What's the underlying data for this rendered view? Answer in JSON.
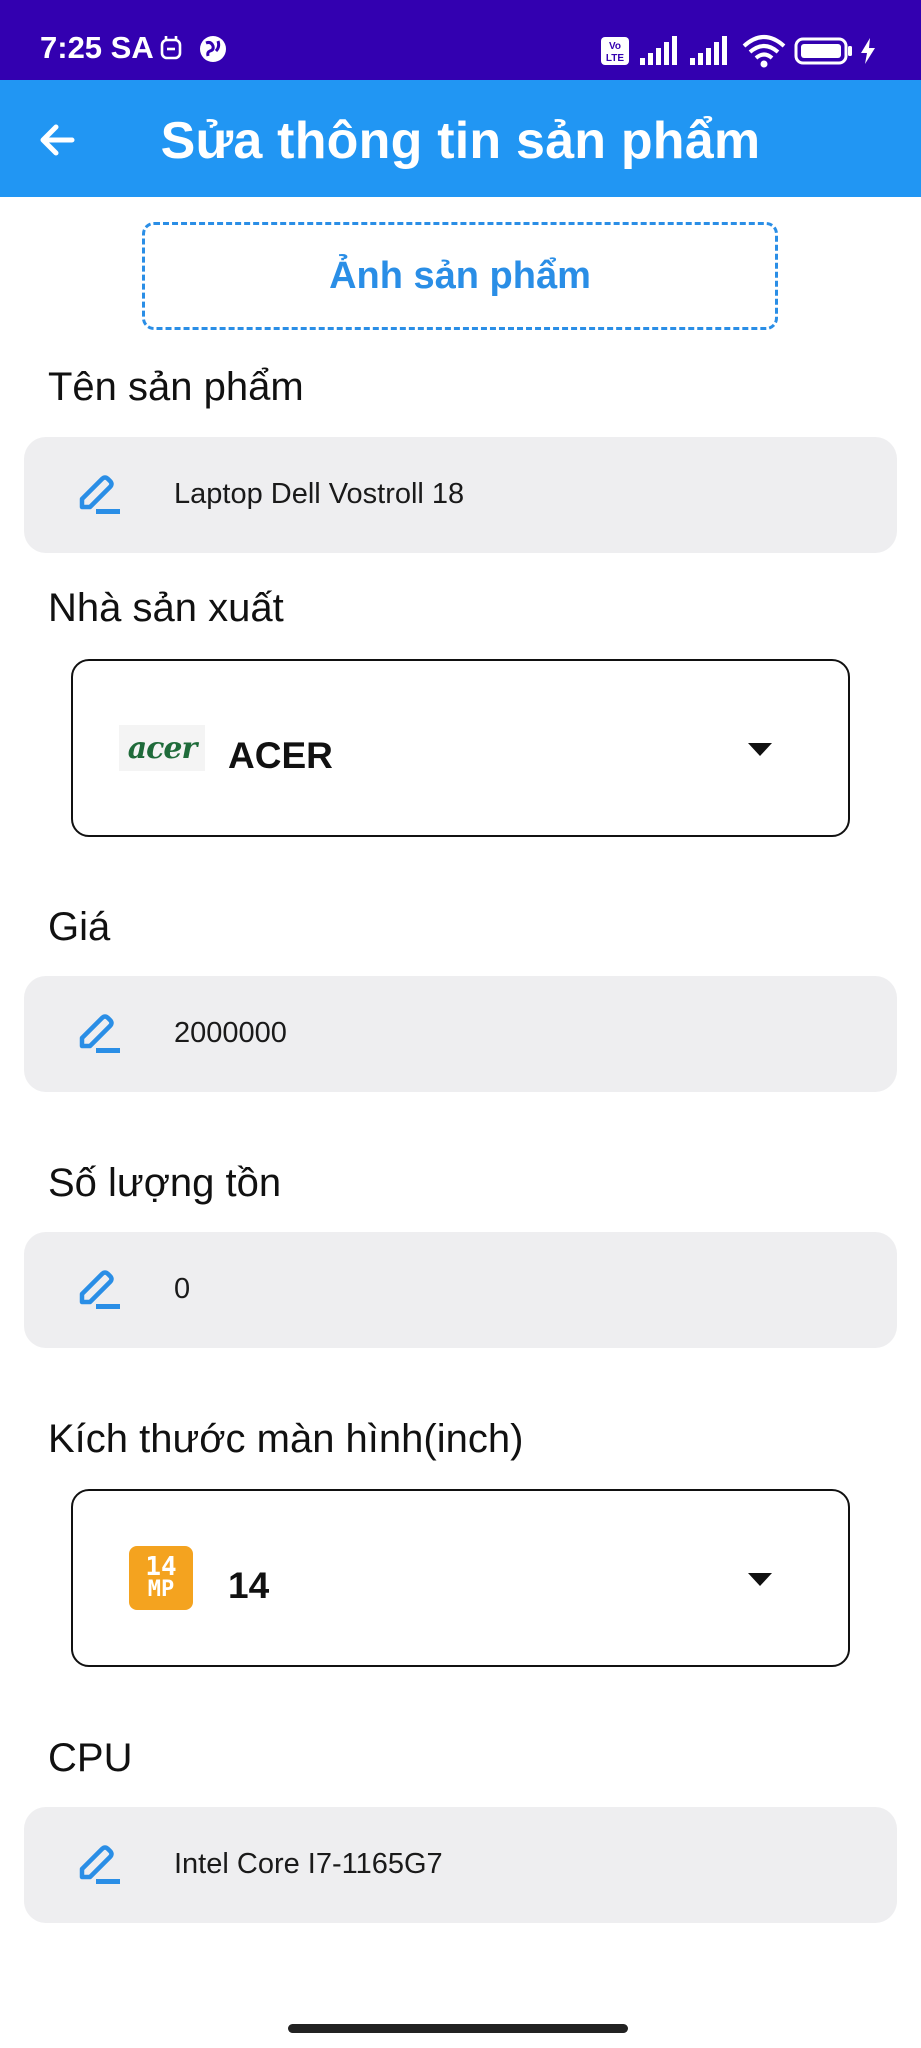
{
  "status_bar": {
    "time": "7:25 SA",
    "icons": [
      "notification-icon",
      "vpn-globe-icon",
      "volte-icon",
      "signal-icon",
      "signal-icon",
      "wifi-icon",
      "battery-icon",
      "charging-icon"
    ]
  },
  "app_bar": {
    "title": "Sửa thông tin sản phẩm",
    "back_icon": "arrow-left-icon"
  },
  "image_picker": {
    "label": "Ảnh sản phẩm"
  },
  "form": {
    "name": {
      "label": "Tên sản phẩm",
      "value": "Laptop Dell Vostroll 18"
    },
    "manufacturer": {
      "label": "Nhà sản xuất",
      "selected": "ACER",
      "logo_text": "acer"
    },
    "price": {
      "label": "Giá",
      "value": "2000000"
    },
    "stock": {
      "label": "Số lượng tồn",
      "value": "0"
    },
    "screen_size": {
      "label": "Kích thước màn hình(inch)",
      "selected": "14",
      "logo_top": "14",
      "logo_bottom": "MP"
    },
    "cpu": {
      "label": "CPU",
      "value": "Intel Core I7-1165G7"
    }
  },
  "colors": {
    "status_bar": "#3300b0",
    "app_bar": "#2196f3",
    "accent": "#2a8ee6",
    "field_bg": "#eeeef0"
  }
}
